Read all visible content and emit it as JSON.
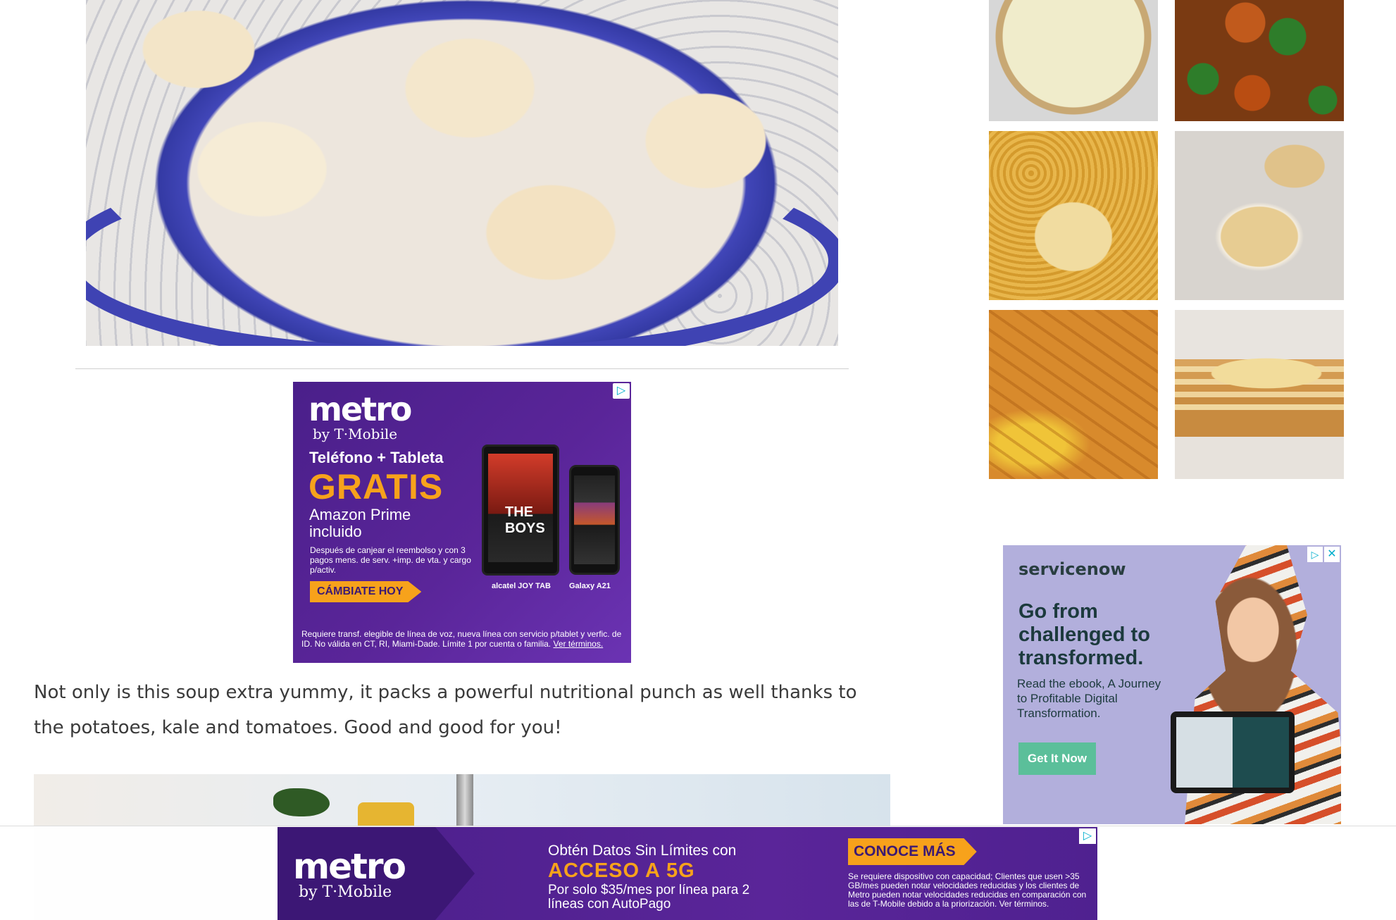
{
  "main": {
    "paragraph": "Not only is this soup extra yummy, it packs a powerful nutritional punch as well thanks to the potatoes, kale and tomatoes. Good and good for you!"
  },
  "ad_metro": {
    "logo_word": "metro",
    "logo_sub": "by T·Mobile",
    "headline": "Teléfono + Tableta",
    "highlight": "GRATIS",
    "subhead": "Amazon Prime incluido",
    "fine_print_1": "Después de canjear el reembolso y con 3 pagos mens. de serv. +imp. de vta. y cargo p/activ.",
    "cta": "CÁMBIATE HOY",
    "tablet_show": "THE BOYS",
    "tablet_label": "alcatel JOY TAB",
    "phone_label": "Galaxy A21",
    "fine_print_2": "Requiere transf. elegible de línea de voz, nueva línea con servicio p/tablet y verfic. de ID. No válida en CT, RI, Miami-Dade. Límite 1 por cuenta o familia.",
    "terms_link": "Ver términos.",
    "colors": {
      "background": "#4a1f8a",
      "accent": "#f7a21b"
    }
  },
  "ad_servicenow": {
    "logo": "servicenow",
    "headline": "Go from challenged to transformed.",
    "subtext": "Read the ebook, A Journey to Profitable Digital Transformation.",
    "cta": "Get It Now",
    "close_icon": "close-icon",
    "colors": {
      "background": "#b2afdc",
      "button": "#5bbf9a"
    }
  },
  "ad_bottom": {
    "logo_word": "metro",
    "logo_sub": "by T·Mobile",
    "line1": "Obtén Datos Sin Límites con",
    "line2": "ACCESO A 5G",
    "line3": "Por solo $35/mes por línea para 2 líneas con AutoPago",
    "cta": "CONOCE MÁS",
    "fine_print": "Se requiere dispositivo con capacidad; Clientes que usen >35 GB/mes pueden notar velocidades reducidas y los clientes de Metro pueden notar velocidades reducidas en comparación con las de T-Mobile debido a la priorización. Ver términos."
  },
  "icons": {
    "ad_choices": "ad-choices-icon",
    "close": "close-icon"
  },
  "glyphs": {
    "ad_choices": "▷",
    "close": "✕"
  }
}
